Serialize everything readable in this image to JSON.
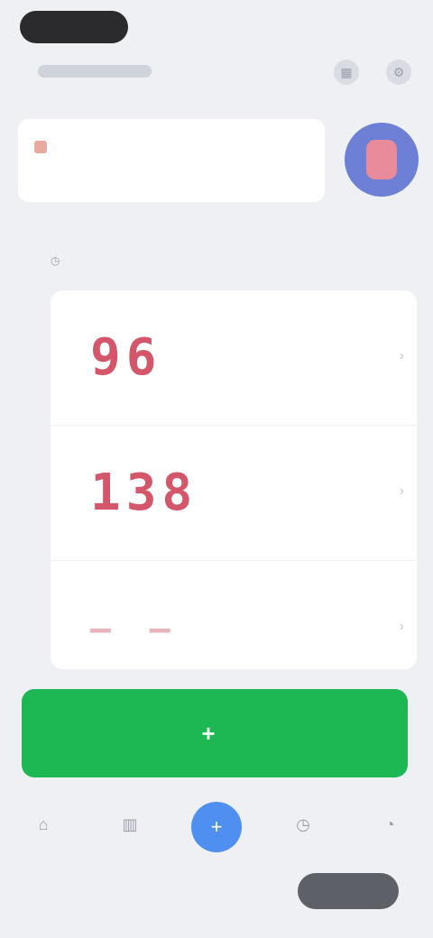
{
  "status": {
    "pill": ""
  },
  "top_icons": {
    "left": "calendar-icon",
    "right": "settings-icon"
  },
  "hero": {
    "title": "",
    "subtitle": ""
  },
  "section": {
    "label": ""
  },
  "list": {
    "items": [
      {
        "big": "96",
        "line1": "",
        "line2": ""
      },
      {
        "big": "138",
        "line1": "",
        "line2": ""
      },
      {
        "big": "— —",
        "line1": "",
        "line2": ""
      }
    ]
  },
  "cta": {
    "label": ""
  },
  "tabs": [
    {
      "icon": "home-icon",
      "label": ""
    },
    {
      "icon": "chart-icon",
      "label": ""
    },
    {
      "icon": "plus-icon",
      "label": ""
    },
    {
      "icon": "history-icon",
      "label": ""
    },
    {
      "icon": "profile-icon",
      "label": ""
    }
  ],
  "footer": {
    "left_text": ""
  },
  "colors": {
    "accent_green": "#1db854",
    "accent_blue": "#4f8ff0",
    "value_red": "#d4566a"
  }
}
